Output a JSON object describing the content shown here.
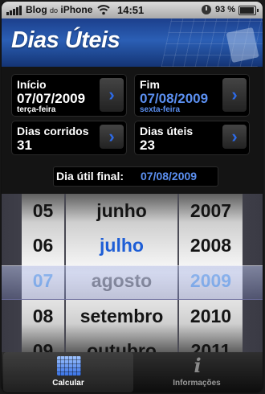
{
  "status_bar": {
    "carrier": "Blog",
    "carrier_small": "do",
    "carrier_end": "iPhone",
    "time": "14:51",
    "battery_percent": "93 %",
    "battery_level": 0.93,
    "icons": [
      "signal-icon",
      "wifi-icon",
      "alarm-icon",
      "battery-icon"
    ]
  },
  "header": {
    "title": "Dias Úteis"
  },
  "inicio": {
    "label": "Início",
    "date": "07/07/2009",
    "weekday": "terça-feira"
  },
  "fim": {
    "label": "Fim",
    "date": "07/08/2009",
    "weekday": "sexta-feira"
  },
  "dias_corridos": {
    "label": "Dias corridos",
    "value": "31"
  },
  "dias_uteis": {
    "label": "Dias úteis",
    "value": "23"
  },
  "final": {
    "label": "Dia útil final:",
    "value": "07/08/2009"
  },
  "picker": {
    "days": [
      "05",
      "06",
      "07",
      "08",
      "09"
    ],
    "months": [
      "junho",
      "julho",
      "agosto",
      "setembro",
      "outubro"
    ],
    "years": [
      "2007",
      "2008",
      "2009",
      "2010",
      "2011"
    ],
    "selected_day": "07",
    "selected_month": "agosto",
    "selected_year": "2009"
  },
  "tabs": [
    {
      "label": "Calcular",
      "icon": "calendar-icon"
    },
    {
      "label": "Informações",
      "icon": "info-icon"
    }
  ],
  "colors": {
    "accent_blue": "#5b8ff0",
    "header_blue": "#2b5fb5"
  }
}
